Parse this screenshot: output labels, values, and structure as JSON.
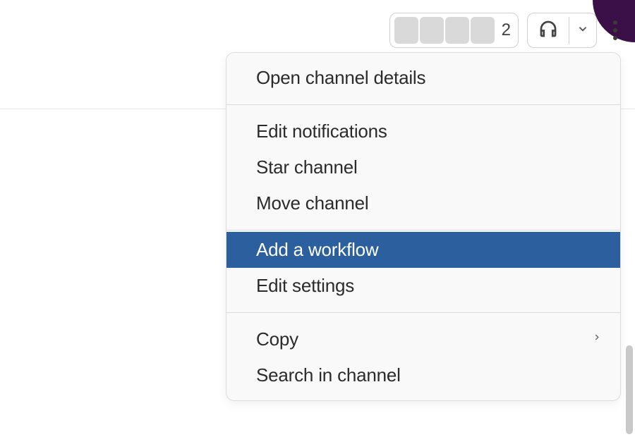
{
  "header": {
    "avatar_count": "2"
  },
  "menu": {
    "items": [
      {
        "label": "Open channel details",
        "highlighted": false,
        "submenu": false
      },
      {
        "label": "Edit notifications",
        "highlighted": false,
        "submenu": false
      },
      {
        "label": "Star channel",
        "highlighted": false,
        "submenu": false
      },
      {
        "label": "Move channel",
        "highlighted": false,
        "submenu": false
      },
      {
        "label": "Add a workflow",
        "highlighted": true,
        "submenu": false
      },
      {
        "label": "Edit settings",
        "highlighted": false,
        "submenu": false
      },
      {
        "label": "Copy",
        "highlighted": false,
        "submenu": true
      },
      {
        "label": "Search in channel",
        "highlighted": false,
        "submenu": false
      }
    ]
  },
  "colors": {
    "highlight_bg": "#2c5f9e",
    "highlight_text": "#ffffff"
  }
}
